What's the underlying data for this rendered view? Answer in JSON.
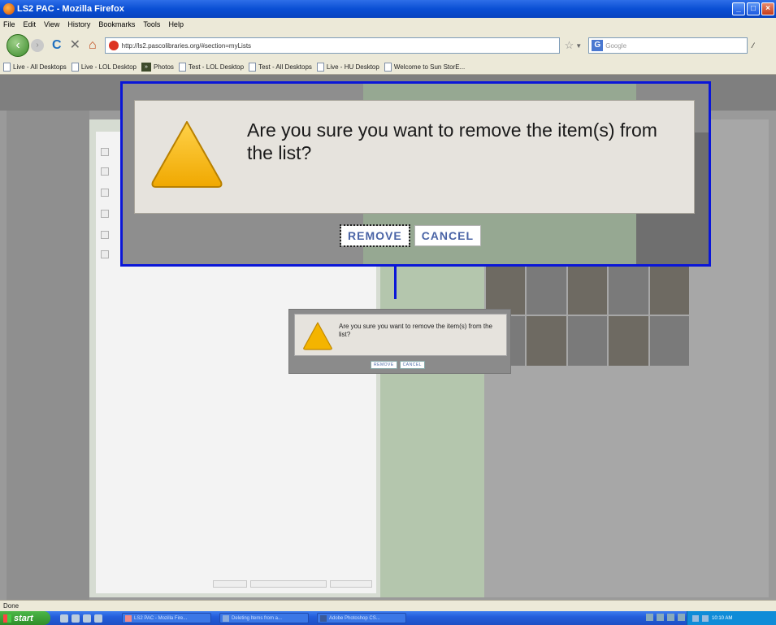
{
  "window": {
    "title": "LS2 PAC - Mozilla Firefox",
    "controls": [
      "_",
      "□",
      "×"
    ]
  },
  "menu": [
    "File",
    "Edit",
    "View",
    "History",
    "Bookmarks",
    "Tools",
    "Help"
  ],
  "navbar": {
    "url": "http://ls2.pascolibraries.org/#section=myLists",
    "search_placeholder": "Google"
  },
  "bookmarks": [
    "Live - All Desktops",
    "Live - LOL Desktop",
    "Photos",
    "Test - LOL Desktop",
    "Test - All Desktops",
    "Live - HU Desktop",
    "Welcome to Sun StorE..."
  ],
  "dialog": {
    "message": "Are you sure you want to remove the item(s) from the list?",
    "remove_label": "REMOVE",
    "cancel_label": "CANCEL"
  },
  "status": {
    "text": "Done"
  },
  "taskbar": {
    "start_label": "start",
    "tasks": [
      "LS2 PAC - Mozilla Fire...",
      "Deleting Items from a...",
      "Adobe Photoshop CS..."
    ],
    "clock": "10:10 AM"
  },
  "colors": {
    "callout_border": "#0a16d8",
    "button_text": "#4a64a6",
    "warning_yellow": "#f4b400"
  }
}
